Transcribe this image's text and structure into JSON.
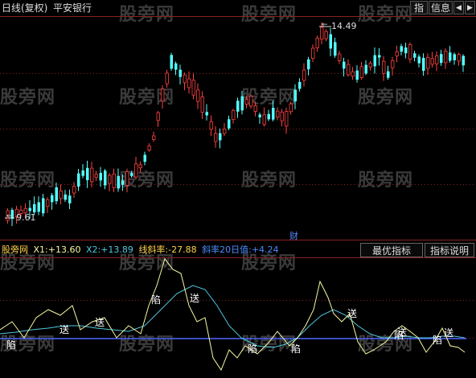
{
  "header": {
    "period": "日线(复权)",
    "stock_name": "平安银行",
    "btn_index": "指",
    "btn_info": "信息",
    "btn_prev": "◀",
    "btn_next": "▶"
  },
  "watermark": "股旁网",
  "price_panel": {
    "high_label": "14.49",
    "low_label": "9.61",
    "finance_marker": "财",
    "up_color": "#ff4040",
    "down_color": "#54ffff"
  },
  "indicator": {
    "name": "股旁网",
    "x1_label": "X1:",
    "x1_value": "+13.60",
    "x2_label": "X2:",
    "x2_value": "+13.89",
    "slope_label": "线斜率:",
    "slope_value": "-27.88",
    "slope20_label": "斜率20日值:",
    "slope20_value": "+4.24",
    "btn_optimal": "最优指标",
    "btn_explain": "指标说明",
    "signal_buy": "陷",
    "signal_sell": "送"
  }
}
